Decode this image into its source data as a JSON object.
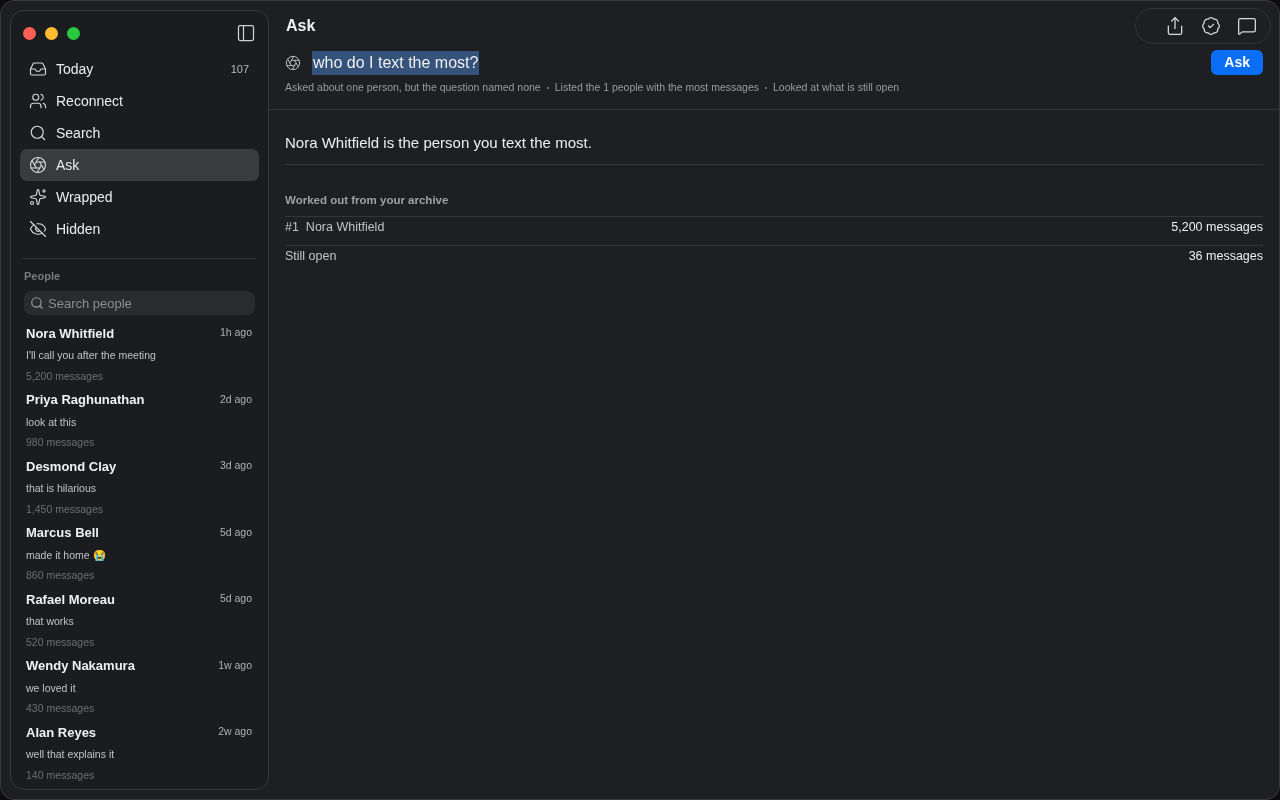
{
  "sidebar": {
    "nav": [
      {
        "label": "Today",
        "kind": "tray",
        "badge": "107",
        "selected": false
      },
      {
        "label": "Reconnect",
        "kind": "people",
        "selected": false
      },
      {
        "label": "Search",
        "kind": "search",
        "selected": false
      },
      {
        "label": "Ask",
        "kind": "ask",
        "selected": true
      },
      {
        "label": "Wrapped",
        "kind": "sparkle",
        "selected": false
      },
      {
        "label": "Hidden",
        "kind": "hidden",
        "selected": false
      }
    ],
    "people_heading": "People",
    "search": {
      "placeholder": "Search people"
    },
    "people": [
      {
        "name": "Nora Whitfield",
        "time": "1h ago",
        "preview": "I'll call you after the meeting",
        "count": "5,200 messages"
      },
      {
        "name": "Priya Raghunathan",
        "time": "2d ago",
        "preview": "look at this",
        "count": "980 messages"
      },
      {
        "name": "Desmond Clay",
        "time": "3d ago",
        "preview": "that is hilarious",
        "count": "1,450 messages"
      },
      {
        "name": "Marcus Bell",
        "time": "5d ago",
        "preview": "made it home 😭",
        "count": "860 messages"
      },
      {
        "name": "Rafael Moreau",
        "time": "5d ago",
        "preview": "that works",
        "count": "520 messages"
      },
      {
        "name": "Wendy Nakamura",
        "time": "1w ago",
        "preview": "we loved it",
        "count": "430 messages"
      },
      {
        "name": "Alan Reyes",
        "time": "2w ago",
        "preview": "well that explains it",
        "count": "140 messages"
      }
    ]
  },
  "title": "Ask",
  "question": {
    "value": "who do I text the most?",
    "button": "Ask"
  },
  "steps": [
    "Asked about one person, but the question named none",
    "Listed the 1 people with the most messages",
    "Looked at what is still open"
  ],
  "answer": "Nora Whitfield is the person you text the most.",
  "details": {
    "heading": "Worked out from your archive",
    "rows": [
      {
        "rank": "#1",
        "label": "Nora Whitfield",
        "value": "5,200 messages"
      },
      {
        "label": "Still open",
        "value": "36 messages"
      }
    ]
  }
}
